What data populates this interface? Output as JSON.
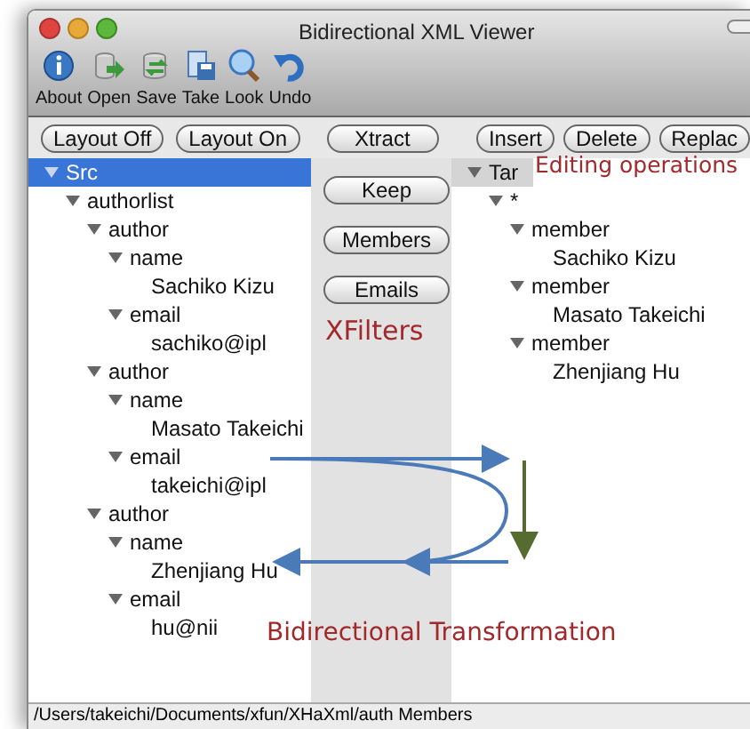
{
  "window": {
    "title": "Bidirectional XML Viewer"
  },
  "toolbar": [
    {
      "label": "About",
      "kind": "info"
    },
    {
      "label": "Open",
      "kind": "open"
    },
    {
      "label": "Save",
      "kind": "save"
    },
    {
      "label": "Take",
      "kind": "take"
    },
    {
      "label": "Look",
      "kind": "look"
    },
    {
      "label": "Undo",
      "kind": "undo"
    }
  ],
  "layout_buttons": [
    "Layout Off",
    "Layout On"
  ],
  "filter_buttons": [
    "Xtract",
    "Keep",
    "Members",
    "Emails"
  ],
  "edit_buttons": [
    "Insert",
    "Delete",
    "Replac"
  ],
  "source_tree": {
    "focused": true,
    "root": {
      "label": "Src",
      "selected": true,
      "expanded": true,
      "children": [
        {
          "label": "authorlist",
          "selected": false,
          "expanded": true,
          "children": [
            {
              "label": "author",
              "selected": false,
              "expanded": true,
              "children": [
                {
                  "label": "name",
                  "selected": false,
                  "expanded": true,
                  "children": [
                    {
                      "label": "Sachiko Kizu",
                      "selected": false
                    }
                  ]
                },
                {
                  "label": "email",
                  "selected": false,
                  "expanded": true,
                  "children": [
                    {
                      "label": "sachiko@ipl",
                      "selected": false
                    }
                  ]
                }
              ]
            },
            {
              "label": "author",
              "selected": false,
              "expanded": true,
              "children": [
                {
                  "label": "name",
                  "selected": false,
                  "expanded": true,
                  "children": [
                    {
                      "label": "Masato Takeichi",
                      "selected": false
                    }
                  ]
                },
                {
                  "label": "email",
                  "selected": false,
                  "expanded": true,
                  "children": [
                    {
                      "label": "takeichi@ipl",
                      "selected": false
                    }
                  ]
                }
              ]
            },
            {
              "label": "author",
              "selected": false,
              "expanded": true,
              "children": [
                {
                  "label": "name",
                  "selected": false,
                  "expanded": true,
                  "children": [
                    {
                      "label": "Zhenjiang Hu",
                      "selected": false
                    }
                  ]
                },
                {
                  "label": "email",
                  "selected": false,
                  "expanded": true,
                  "children": [
                    {
                      "label": "hu@nii",
                      "selected": false
                    }
                  ]
                }
              ]
            }
          ]
        }
      ]
    }
  },
  "target_tree": {
    "focused": false,
    "root": {
      "label": "Tar",
      "selected": true,
      "expanded": true,
      "children": [
        {
          "label": "*",
          "selected": false,
          "expanded": true,
          "children": [
            {
              "label": "member",
              "selected": false,
              "expanded": true,
              "children": [
                {
                  "label": "Sachiko Kizu",
                  "selected": false
                }
              ]
            },
            {
              "label": "member",
              "selected": false,
              "expanded": true,
              "children": [
                {
                  "label": "Masato Takeichi",
                  "selected": false
                }
              ]
            },
            {
              "label": "member",
              "selected": false,
              "expanded": true,
              "children": [
                {
                  "label": "Zhenjiang Hu",
                  "selected": false
                }
              ]
            }
          ]
        }
      ]
    }
  },
  "annotations": {
    "editing": "Editing operations",
    "filters": "XFilters",
    "transformation": "Bidirectional Transformation"
  },
  "status_bar": "/Users/takeichi/Documents/xfun/XHaXml/auth  Members"
}
